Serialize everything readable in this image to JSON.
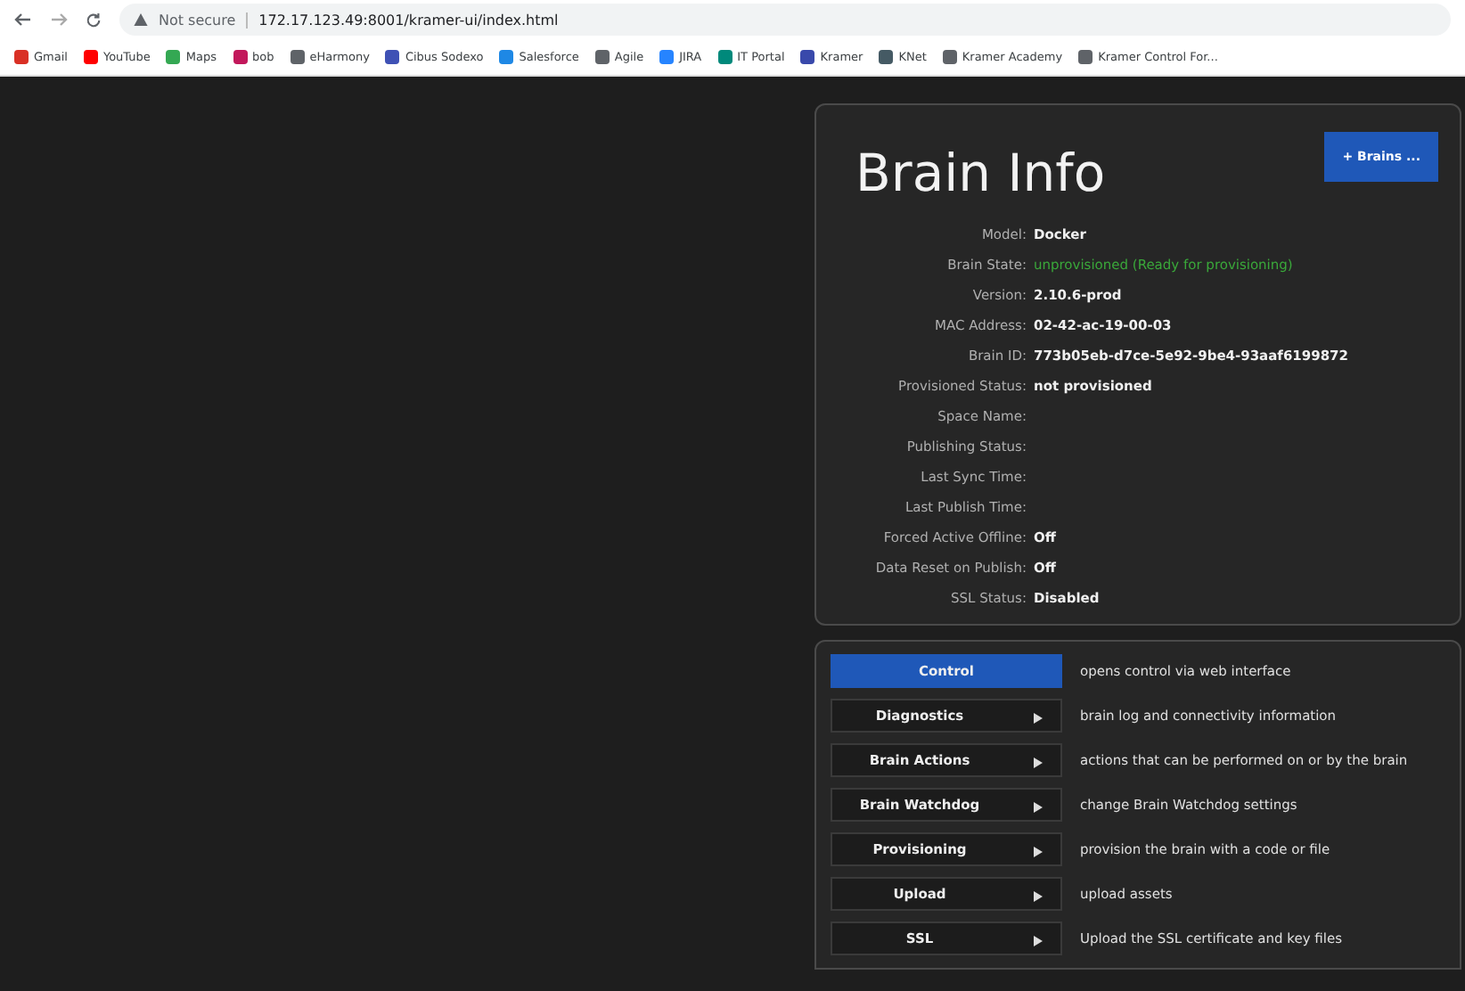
{
  "browser": {
    "security": "Not secure",
    "url": "172.17.123.49:8001/kramer-ui/index.html",
    "bookmarks": [
      {
        "label": "Gmail",
        "color": "#d93025"
      },
      {
        "label": "YouTube",
        "color": "#ff0000"
      },
      {
        "label": "Maps",
        "color": "#34a853"
      },
      {
        "label": "bob",
        "color": "#c2185b"
      },
      {
        "label": "eHarmony",
        "color": "#5f6368"
      },
      {
        "label": "Cibus Sodexo",
        "color": "#3f51b5"
      },
      {
        "label": "Salesforce",
        "color": "#1e88e5"
      },
      {
        "label": "Agile",
        "color": "#5f6368"
      },
      {
        "label": "JIRA",
        "color": "#2684ff"
      },
      {
        "label": "IT Portal",
        "color": "#00897b"
      },
      {
        "label": "Kramer",
        "color": "#3949ab"
      },
      {
        "label": "KNet",
        "color": "#455a64"
      },
      {
        "label": "Kramer Academy",
        "color": "#5f6368"
      },
      {
        "label": "Kramer Control For...",
        "color": "#5f6368"
      }
    ]
  },
  "info": {
    "title": "Brain Info",
    "button": "+ Brains ...",
    "rows": [
      {
        "label": "Model:",
        "value": "Docker",
        "kind": "text"
      },
      {
        "label": "Brain State:",
        "value": "unprovisioned (Ready for provisioning)",
        "kind": "status"
      },
      {
        "label": "Version:",
        "value": "2.10.6-prod",
        "kind": "text"
      },
      {
        "label": "MAC Address:",
        "value": "02-42-ac-19-00-03",
        "kind": "text"
      },
      {
        "label": "Brain ID:",
        "value": "773b05eb-d7ce-5e92-9be4-93aaf6199872",
        "kind": "text"
      },
      {
        "label": "Provisioned Status:",
        "value": "not provisioned",
        "kind": "text"
      },
      {
        "label": "Space Name:",
        "kind": "text"
      },
      {
        "label": "Publishing Status:",
        "kind": "text"
      },
      {
        "label": "Last Sync Time:",
        "kind": "text"
      },
      {
        "label": "Last Publish Time:",
        "kind": "text"
      },
      {
        "label": "Forced Active Offline:",
        "value": "Off",
        "kind": "text"
      },
      {
        "label": "Data Reset on Publish:",
        "value": "Off",
        "kind": "text"
      },
      {
        "label": "SSL Status:",
        "value": "Disabled",
        "kind": "text"
      }
    ]
  },
  "menu": [
    {
      "label": "Control",
      "arrow": false,
      "selected": true,
      "description": "opens control via web interface"
    },
    {
      "label": "Diagnostics",
      "arrow": true,
      "selected": false,
      "description": "brain log and connectivity information"
    },
    {
      "label": "Brain Actions",
      "arrow": true,
      "selected": false,
      "description": "actions that can be performed on or by the brain"
    },
    {
      "label": "Brain Watchdog",
      "arrow": true,
      "selected": false,
      "description": "change Brain Watchdog settings"
    },
    {
      "label": "Provisioning",
      "arrow": true,
      "selected": false,
      "description": "provision the brain with a code or file"
    },
    {
      "label": "Upload",
      "arrow": true,
      "selected": false,
      "description": "upload assets"
    },
    {
      "label": "SSL",
      "arrow": true,
      "selected": false,
      "description": "Upload the SSL certificate and key files"
    }
  ]
}
